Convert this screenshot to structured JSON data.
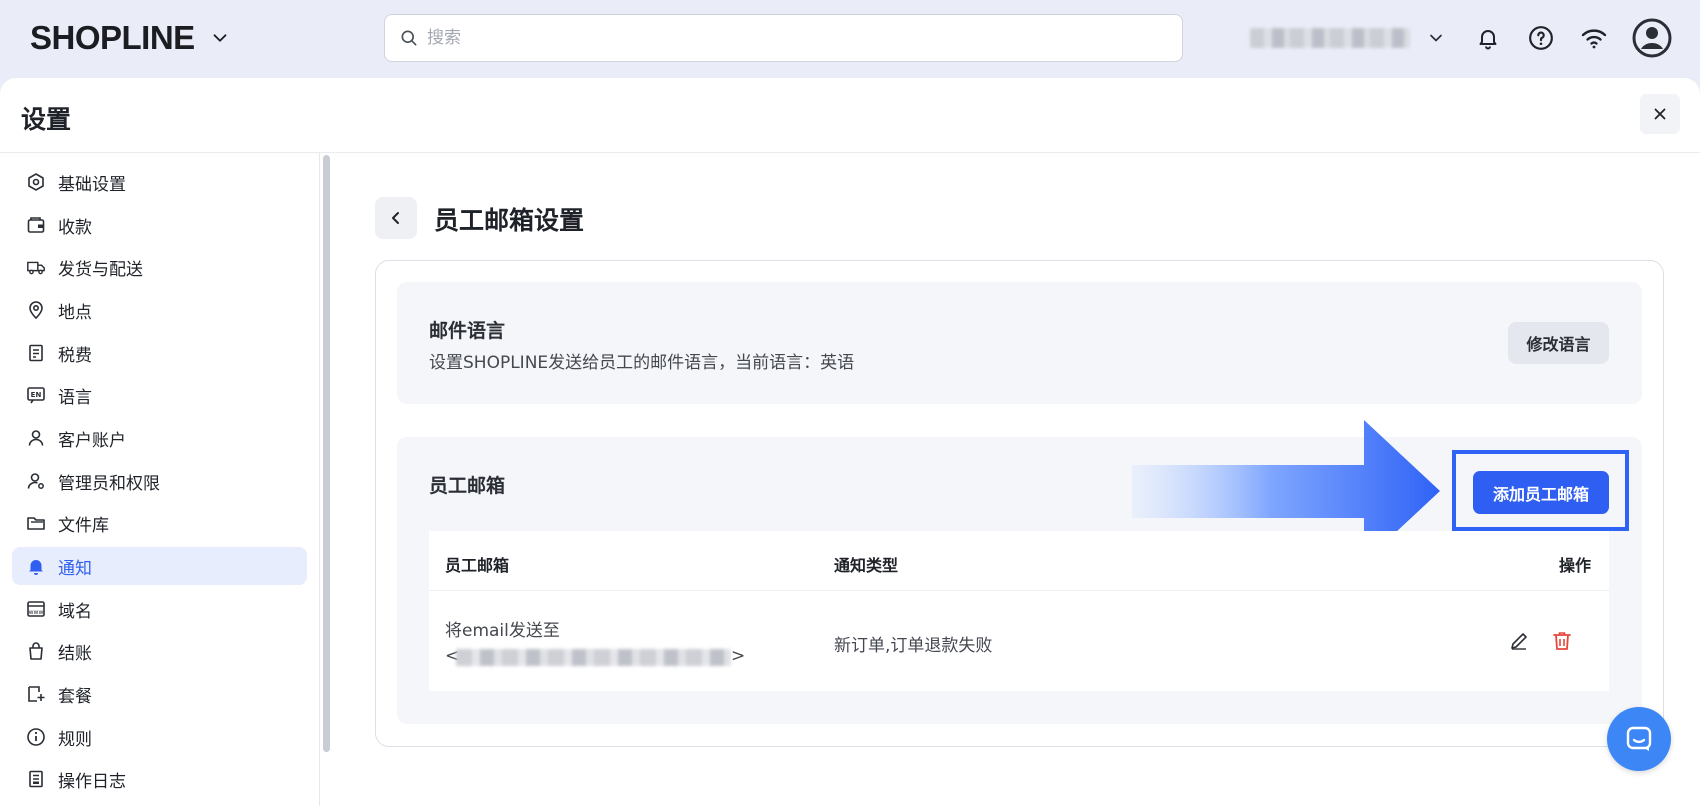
{
  "header": {
    "logo": "SHOPLINE",
    "search_placeholder": "搜索",
    "icons": [
      "chevron-down-icon",
      "search-icon",
      "bell-icon",
      "help-icon",
      "wifi-icon",
      "user-avatar-icon"
    ]
  },
  "panel": {
    "title": "设置",
    "close_icon": "close-icon"
  },
  "sidebar": {
    "items": [
      {
        "label": "基础设置",
        "icon": "hexagon-settings-icon"
      },
      {
        "label": "收款",
        "icon": "wallet-icon"
      },
      {
        "label": "发货与配送",
        "icon": "truck-icon"
      },
      {
        "label": "地点",
        "icon": "location-pin-icon"
      },
      {
        "label": "税费",
        "icon": "tax-receipt-icon"
      },
      {
        "label": "语言",
        "icon": "language-en-icon"
      },
      {
        "label": "客户账户",
        "icon": "user-icon"
      },
      {
        "label": "管理员和权限",
        "icon": "user-admin-icon"
      },
      {
        "label": "文件库",
        "icon": "folder-icon"
      },
      {
        "label": "通知",
        "icon": "bell-icon",
        "active": true
      },
      {
        "label": "域名",
        "icon": "domain-icon"
      },
      {
        "label": "结账",
        "icon": "shopping-bag-icon"
      },
      {
        "label": "套餐",
        "icon": "plan-icon"
      },
      {
        "label": "规则",
        "icon": "info-icon"
      },
      {
        "label": "操作日志",
        "icon": "log-icon"
      }
    ]
  },
  "main": {
    "title": "员工邮箱设置",
    "mail_language": {
      "title": "邮件语言",
      "description": "设置SHOPLINE发送给员工的邮件语言，当前语言：英语",
      "button": "修改语言"
    },
    "staff_email": {
      "title": "员工邮箱",
      "add_button": "添加员工邮箱",
      "columns": [
        "员工邮箱",
        "通知类型",
        "操作"
      ],
      "rows": [
        {
          "email_line1": "将email发送至",
          "email_open": "<",
          "email_close": ">",
          "types": "新订单,订单退款失败"
        }
      ]
    }
  },
  "colors": {
    "primary": "#2f5ef2",
    "highlight_frame": "#2f63f6",
    "active_bg": "#e8edfd",
    "danger": "#e5483b",
    "chat": "#3c87f5"
  }
}
